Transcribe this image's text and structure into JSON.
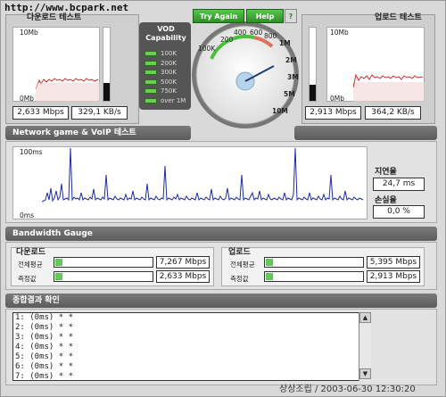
{
  "watermark": "http://www.bcpark.net",
  "download_header": "다운로드 테스트",
  "upload_header": "업로드 테스트",
  "mini_download": {
    "top_label": "10Mb",
    "bottom_label": "0Mb",
    "speed": "2,633 Mbps",
    "rate": "329,1 KB/s"
  },
  "mini_upload": {
    "top_label": "10Mb",
    "bottom_label": "0Mb",
    "speed": "2,913 Mbps",
    "rate": "364,2 KB/s"
  },
  "vod": {
    "title": "VOD Capability",
    "levels": [
      "100K",
      "200K",
      "300K",
      "500K",
      "750K",
      "over 1M"
    ]
  },
  "buttons": {
    "try_again": "Try Again",
    "help": "Help",
    "help_icon": "?"
  },
  "gauge": {
    "ticks": [
      "200",
      "400",
      "600",
      "800",
      "1M",
      "2M",
      "3M",
      "5M",
      "10M",
      "100K"
    ],
    "value_note": "needle"
  },
  "network_section": {
    "title": "Network game & VoIP 테스트",
    "top_label": "100ms",
    "bottom_label": "0ms",
    "latency_label": "지연율",
    "latency_value": "24,7 ms",
    "loss_label": "손실율",
    "loss_value": "0,0 %"
  },
  "bandwidth_section": {
    "title": "Bandwidth Gauge"
  },
  "bw_download": {
    "title": "다운로드",
    "avg_label": "전체평균",
    "avg_value": "7,267 Mbps",
    "avg_fill": 0.07,
    "meas_label": "측정값",
    "meas_value": "2,633 Mbps",
    "meas_fill": 0.03
  },
  "bw_upload": {
    "title": "업로드",
    "avg_label": "전체평균",
    "avg_value": "5,395 Mbps",
    "avg_fill": 0.05,
    "meas_label": "측정값",
    "meas_value": "2,913 Mbps",
    "meas_fill": 0.03
  },
  "result_section": {
    "title": "종합결과 확인"
  },
  "log_lines": [
    "1: (0ms) * *",
    "2: (0ms) * *",
    "3: (0ms) * *",
    "4: (0ms) * *",
    "5: (0ms) * *",
    "6: (0ms) * *",
    "7: (0ms) * *"
  ],
  "footer": "상상조립 / 2003-06-30 12:30:20",
  "colors": {
    "accent_green": "#3aa82f",
    "graph_line": "#d42a2a",
    "ping_line": "#1b2aa8"
  }
}
